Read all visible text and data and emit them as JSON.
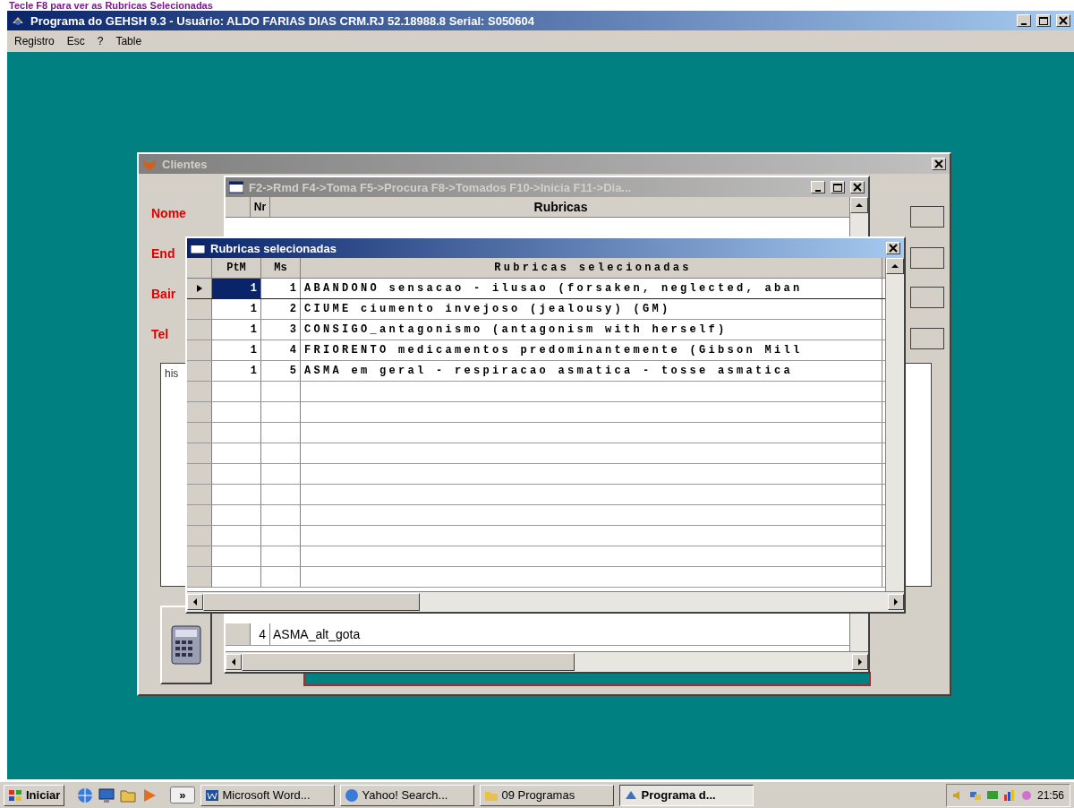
{
  "banner": {
    "text": "Tecle F8 para ver as Rubricas Selecionadas"
  },
  "window": {
    "title": "Programa do GEHSH 9.3 -  Usuário: ALDO FARIAS DIAS CRM.RJ 52.18988.8   Serial: S050604",
    "active": true
  },
  "menu": [
    {
      "label": "Registro"
    },
    {
      "label": "Esc"
    },
    {
      "label": "?"
    },
    {
      "label": "Table"
    }
  ],
  "clientes": {
    "title": "Clientes",
    "active": false,
    "labels": [
      {
        "text": "Nome"
      },
      {
        "text": "End"
      },
      {
        "text": "Bair"
      },
      {
        "text": "Tel"
      }
    ],
    "memo": {
      "value": "his"
    }
  },
  "rubricas": {
    "title": "F2->Rmd F4->Toma F5->Procura F8->Tomados F10->Inicia F11->Dia...",
    "active": false,
    "columns": [
      "Nr",
      "Rubricas"
    ],
    "rows": [
      {
        "nr": "4",
        "text": "ASMA_alt_gota"
      }
    ]
  },
  "selecionadas": {
    "title": "Rubricas selecionadas",
    "active": true,
    "columns": [
      "PtM",
      "Ms",
      "Rubricas selecionadas"
    ],
    "rows": [
      {
        "ptm": "1",
        "ms": "1",
        "text": "ABANDONO sensacao - ilusao (forsaken, neglected, aban",
        "selected": true
      },
      {
        "ptm": "1",
        "ms": "2",
        "text": "CIUME  ciumento invejoso (jealousy) (GM)",
        "selected": false
      },
      {
        "ptm": "1",
        "ms": "3",
        "text": "CONSIGO_antagonismo (antagonism with herself)",
        "selected": false
      },
      {
        "ptm": "1",
        "ms": "4",
        "text": "FRIORENTO medicamentos predominantemente (Gibson Mill",
        "selected": false
      },
      {
        "ptm": "1",
        "ms": "5",
        "text": "ASMA em geral - respiracao asmatica - tosse asmatica",
        "selected": false
      }
    ]
  },
  "taskbar": {
    "start": "Iniciar",
    "quick_more": "»",
    "tasks": [
      {
        "label": "Microsoft Word...",
        "selected": false
      },
      {
        "label": "Yahoo! Search...",
        "selected": false
      },
      {
        "label": "09 Programas",
        "selected": false
      },
      {
        "label": "Programa d...",
        "selected": true
      }
    ],
    "clock": "21:56"
  }
}
